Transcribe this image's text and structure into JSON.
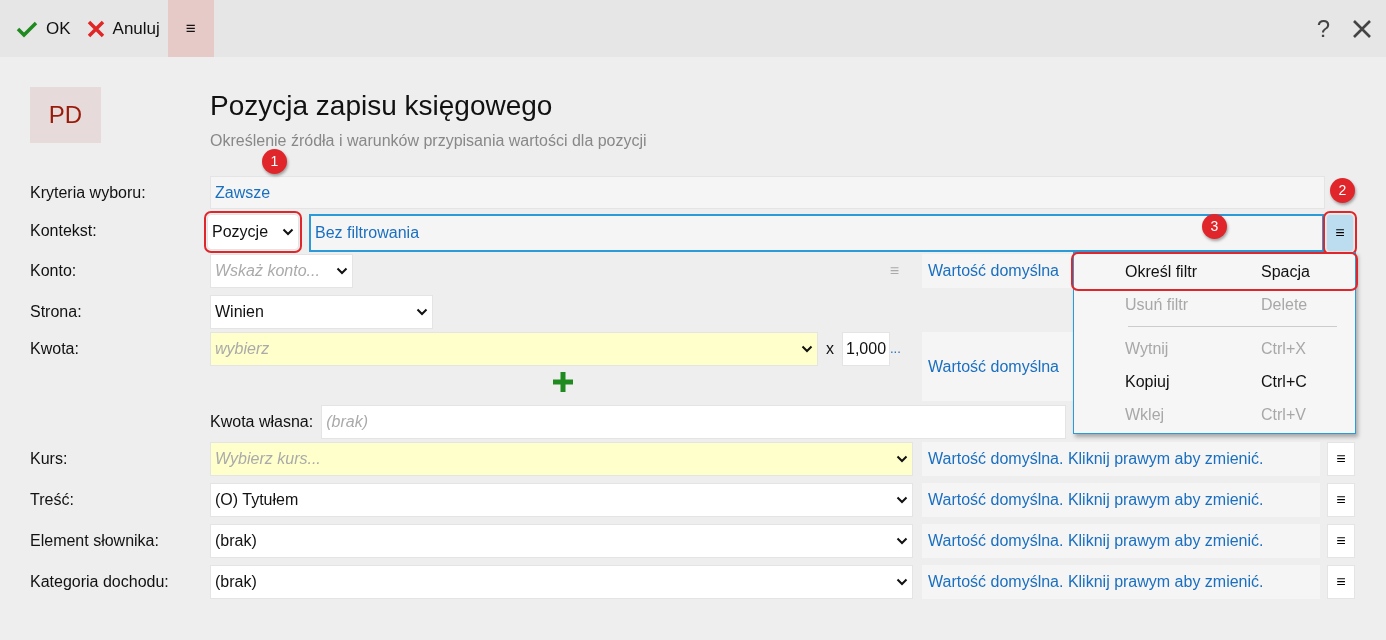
{
  "toolbar": {
    "buttons": [
      {
        "kind": "ok",
        "label": "OK",
        "active": false
      },
      {
        "kind": "cancel",
        "label": "Anuluj",
        "active": false
      },
      {
        "kind": "menu",
        "label": "≡",
        "active": true
      }
    ],
    "help": "?"
  },
  "header": {
    "badge": "PD",
    "title": "Pozycja zapisu księgowego",
    "subtitle": "Określenie źródła i warunków przypisania wartości dla pozycji"
  },
  "rows": [
    {
      "kind": "link",
      "label": "Kryteria wyboru:",
      "value": "Zawsze"
    },
    {
      "kind": "context",
      "label": "Kontekst:",
      "dropdown": {
        "value": "Pozycje",
        "annotated": true
      },
      "filter": "Bez filtrowania",
      "menu_button": {
        "label": "≡",
        "annotated": true,
        "selected": true
      }
    },
    {
      "kind": "account",
      "label": "Konto:",
      "placeholder": "Wskaż konto...",
      "menu_label": "≡",
      "default_value": "Wartość domyślna"
    },
    {
      "kind": "side",
      "label": "Strona:",
      "value": "Winien"
    },
    {
      "kind": "amount",
      "label": "Kwota:",
      "placeholder": "wybierz",
      "required": true,
      "multiplier_sign": "x",
      "multiplier": "1,000",
      "more": "...",
      "default_value": "Wartość domyślna"
    },
    {
      "kind": "own_amount",
      "label": "Kwota własna:",
      "placeholder": "(brak)"
    },
    {
      "kind": "select",
      "label": "Kurs:",
      "placeholder": "Wybierz kurs...",
      "required": true,
      "default_value": "Wartość domyślna. Kliknij prawym aby zmienić.",
      "menu_label": "≡"
    },
    {
      "kind": "select",
      "label": "Treść:",
      "value": "(O) Tytułem",
      "required": false,
      "default_value": "Wartość domyślna. Kliknij prawym aby zmienić.",
      "menu_label": "≡"
    },
    {
      "kind": "select",
      "label": "Element słownika:",
      "value": "(brak)",
      "required": false,
      "default_value": "Wartość domyślna. Kliknij prawym aby zmienić.",
      "menu_label": "≡"
    },
    {
      "kind": "select",
      "label": "Kategoria dochodu:",
      "value": "(brak)",
      "required": false,
      "default_value": "Wartość domyślna. Kliknij prawym aby zmienić.",
      "menu_label": "≡"
    }
  ],
  "context_menu": {
    "items": [
      {
        "kind": "item",
        "label": "Określ filtr",
        "shortcut": "Spacja",
        "disabled": false,
        "annotated": true
      },
      {
        "kind": "item",
        "label": "Usuń filtr",
        "shortcut": "Delete",
        "disabled": true,
        "annotated": false
      },
      {
        "kind": "separator"
      },
      {
        "kind": "item",
        "label": "Wytnij",
        "shortcut": "Ctrl+X",
        "disabled": true,
        "annotated": false
      },
      {
        "kind": "item",
        "label": "Kopiuj",
        "shortcut": "Ctrl+C",
        "disabled": false,
        "annotated": false
      },
      {
        "kind": "item",
        "label": "Wklej",
        "shortcut": "Ctrl+V",
        "disabled": true,
        "annotated": false
      }
    ]
  },
  "annotations": [
    {
      "number": "1"
    },
    {
      "number": "2"
    },
    {
      "number": "3"
    }
  ]
}
